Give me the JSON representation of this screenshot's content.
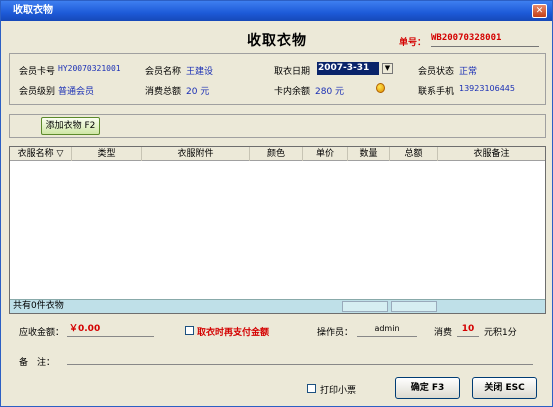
{
  "window": {
    "title": "收取衣物",
    "close_glyph": "✕"
  },
  "heading": "收取衣物",
  "order": {
    "label": "单号：",
    "value": "WB20070328001"
  },
  "member": {
    "card_label": "会员卡号",
    "card_value": "HY20070321001",
    "name_label": "会员名称",
    "name_value": "王建设",
    "date_label": "取衣日期",
    "date_value": "2007-3-31",
    "status_label": "会员状态",
    "status_value": "正常",
    "level_label": "会员级别",
    "level_value": "普通会员",
    "total_label": "消费总额",
    "total_value": "20 元",
    "balance_label": "卡内余额",
    "balance_value": "280 元",
    "phone_label": "联系手机",
    "phone_value": "13923106445"
  },
  "add_button": "添加衣物 F2",
  "table": {
    "columns": [
      "衣服名称 ▽",
      "类型",
      "衣服附件",
      "颜色",
      "单价",
      "数量",
      "总额",
      "衣服备注"
    ],
    "rows": [],
    "footer": "共有0件衣物"
  },
  "amount": {
    "label": "应收金额：",
    "value": "￥0.00"
  },
  "pay_later_label": "取衣时再支付金额",
  "operator": {
    "label": "操作员：",
    "value": "admin"
  },
  "points": {
    "label": "消费",
    "value": "10",
    "suffix": "元积1分"
  },
  "remark_label": "备　注：",
  "print_label": "打印小票",
  "confirm_button": "确定 F3",
  "close_button": "关闭 ESC"
}
